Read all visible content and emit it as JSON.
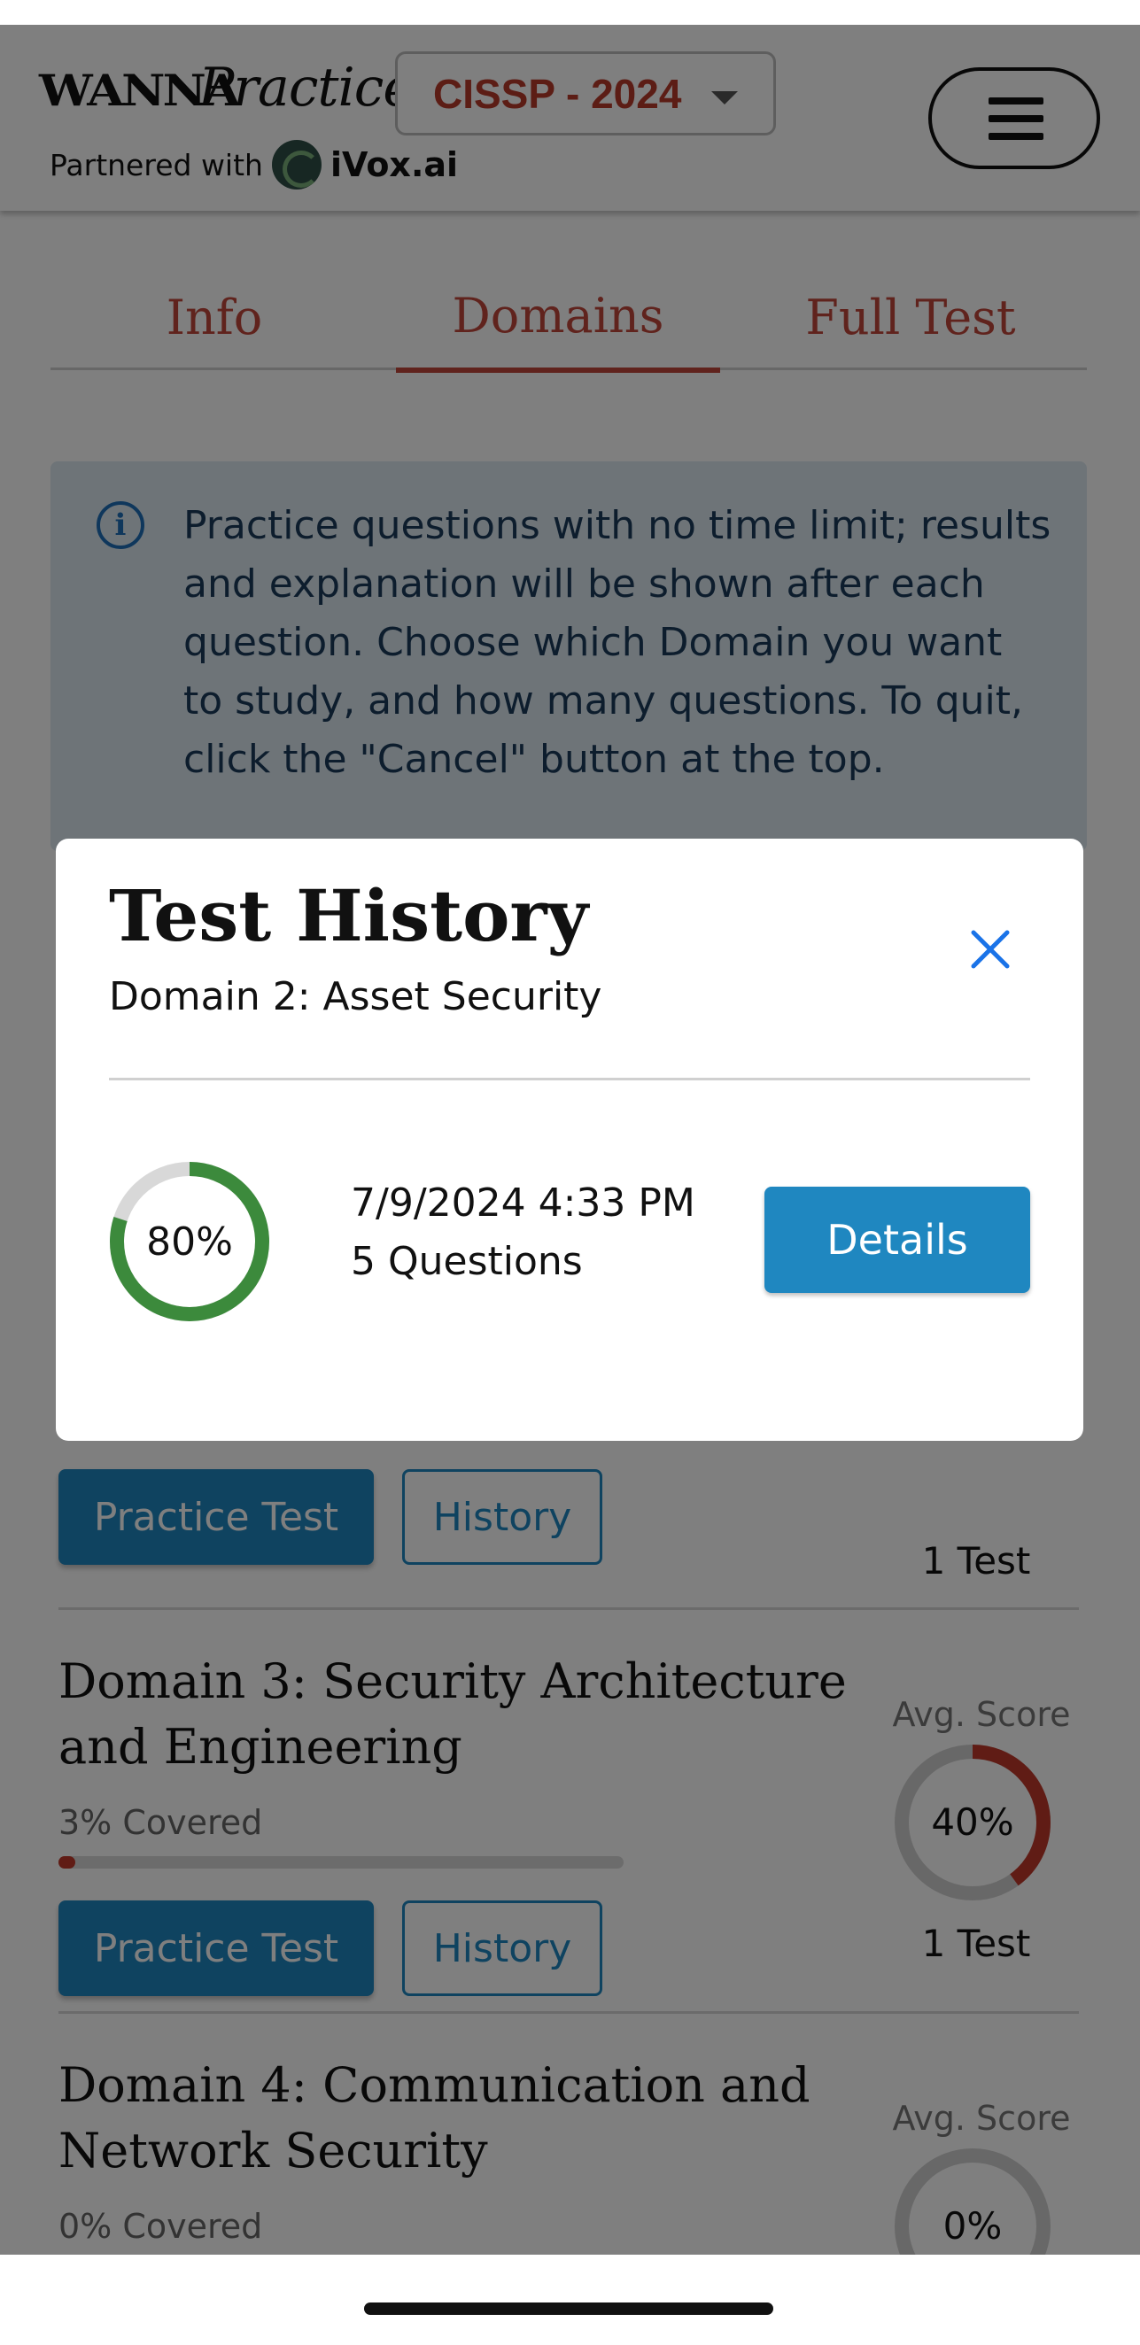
{
  "header": {
    "logo_wanna": "WANNA",
    "logo_practice": "Practice",
    "partner_text": "Partnered with",
    "partner_brand": "iVox.ai",
    "exam_selector": "CISSP - 2024"
  },
  "tabs": [
    {
      "label": "Info",
      "active": false
    },
    {
      "label": "Domains",
      "active": true
    },
    {
      "label": "Full Test",
      "active": false
    }
  ],
  "info": {
    "icon": "info-icon",
    "text": "Practice questions with no time limit; results and explanation will be shown after each question. Choose which Domain you want to study, and how many questions. To quit, click the \"Cancel\" button at the top."
  },
  "domains": [
    {
      "practice_label": "Practice Test",
      "history_label": "History",
      "tests": "1 Test",
      "ring_color": "#3c8a3c"
    },
    {
      "title": "Domain 3: Security Architecture and Engineering",
      "covered": "3% Covered",
      "covered_fraction": 0.03,
      "avg_label": "Avg. Score",
      "avg_score": "40%",
      "avg_fraction": 0.4,
      "ring_color": "#c0392b",
      "practice_label": "Practice Test",
      "history_label": "History",
      "tests": "1 Test"
    },
    {
      "title": "Domain 4: Communication and Network Security",
      "covered": "0% Covered",
      "covered_fraction": 0.0,
      "avg_label": "Avg. Score",
      "avg_score": "0%",
      "avg_fraction": 0.0
    }
  ],
  "modal": {
    "title": "Test History",
    "subtitle": "Domain 2: Asset Security",
    "close_icon": "close-icon",
    "entries": [
      {
        "score": "80%",
        "score_fraction": 0.8,
        "ring_color": "#3c8a3c",
        "date": "7/9/2024 4:33 PM",
        "questions": "5 Questions",
        "details_label": "Details"
      }
    ]
  }
}
